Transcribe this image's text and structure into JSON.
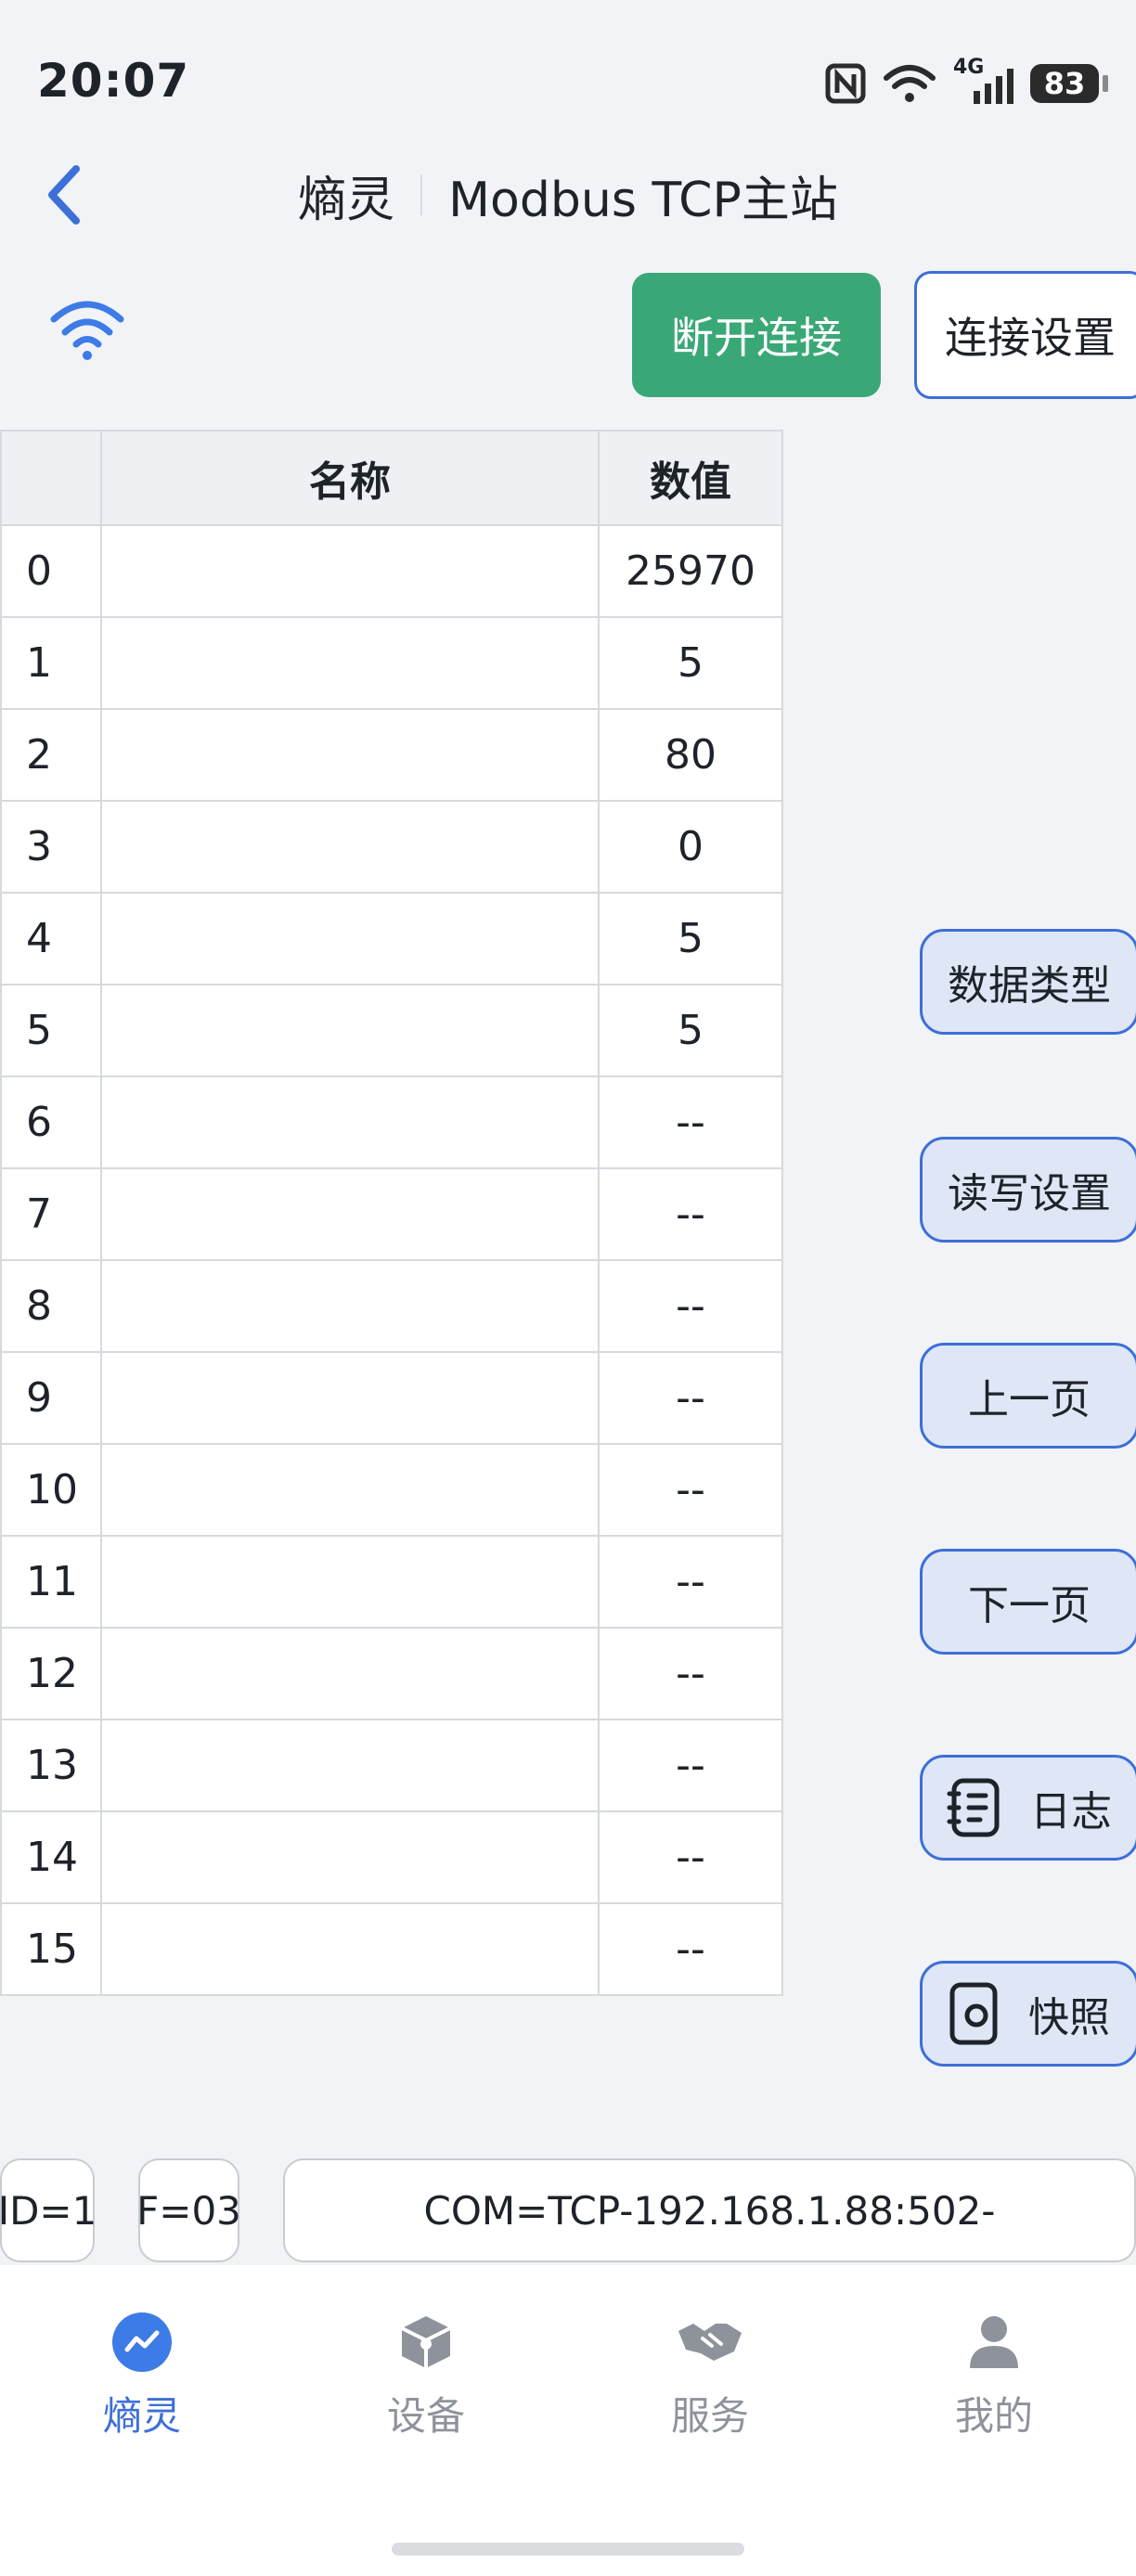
{
  "status_bar": {
    "time": "20:07",
    "network": "4G",
    "battery": "83",
    "icons": [
      "nfc-icon",
      "wifi-icon",
      "signal-icon",
      "battery-icon"
    ]
  },
  "header": {
    "back_icon": "chevron-left-icon",
    "app_name": "熵灵",
    "page_title": "Modbus TCP主站"
  },
  "toolbar": {
    "connection_icon": "wifi-icon",
    "disconnect_label": "断开连接",
    "connection_settings_label": "连接设置"
  },
  "table": {
    "columns": [
      "",
      "名称",
      "数值"
    ],
    "rows": [
      {
        "index": "0",
        "name": "",
        "value": "25970"
      },
      {
        "index": "1",
        "name": "",
        "value": "5"
      },
      {
        "index": "2",
        "name": "",
        "value": "80"
      },
      {
        "index": "3",
        "name": "",
        "value": "0"
      },
      {
        "index": "4",
        "name": "",
        "value": "5"
      },
      {
        "index": "5",
        "name": "",
        "value": "5"
      },
      {
        "index": "6",
        "name": "",
        "value": "--"
      },
      {
        "index": "7",
        "name": "",
        "value": "--"
      },
      {
        "index": "8",
        "name": "",
        "value": "--"
      },
      {
        "index": "9",
        "name": "",
        "value": "--"
      },
      {
        "index": "10",
        "name": "",
        "value": "--"
      },
      {
        "index": "11",
        "name": "",
        "value": "--"
      },
      {
        "index": "12",
        "name": "",
        "value": "--"
      },
      {
        "index": "13",
        "name": "",
        "value": "--"
      },
      {
        "index": "14",
        "name": "",
        "value": "--"
      },
      {
        "index": "15",
        "name": "",
        "value": "--"
      }
    ]
  },
  "side_buttons": {
    "data_type": "数据类型",
    "read_write_settings": "读写设置",
    "prev_page": "上一页",
    "next_page": "下一页",
    "log": "日志",
    "snapshot": "快照"
  },
  "info_bar": {
    "slave_id": "ID=1",
    "function": "F=03",
    "com": "COM=TCP-192.168.1.88:502-"
  },
  "bottom_nav": {
    "items": [
      {
        "label": "熵灵",
        "icon": "chart-icon",
        "active": true
      },
      {
        "label": "设备",
        "icon": "cube-icon",
        "active": false
      },
      {
        "label": "服务",
        "icon": "handshake-icon",
        "active": false
      },
      {
        "label": "我的",
        "icon": "user-icon",
        "active": false
      }
    ]
  },
  "colors": {
    "accent": "#3d6fd8",
    "connect_green": "#3aa876",
    "background": "#f1f3f6"
  }
}
